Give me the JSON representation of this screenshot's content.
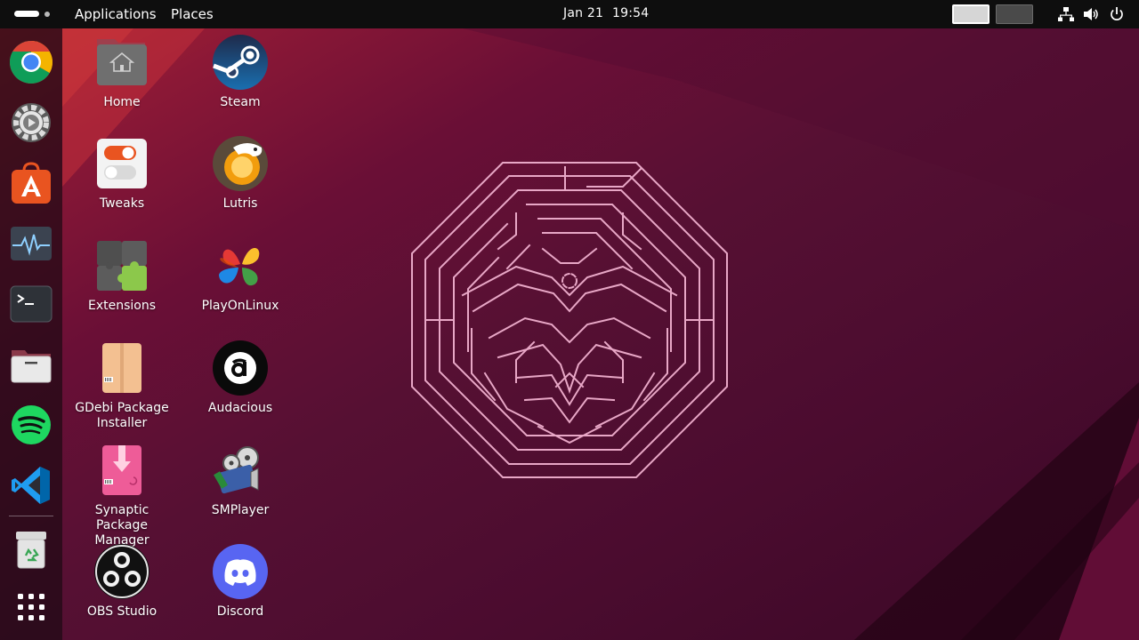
{
  "topbar": {
    "applications": "Applications",
    "places": "Places",
    "date": "Jan 21",
    "time": "19:54",
    "icons": [
      "network-icon",
      "volume-icon",
      "power-icon"
    ]
  },
  "dock": {
    "items": [
      {
        "name": "Google Chrome",
        "icon": "chrome-icon"
      },
      {
        "name": "Settings",
        "icon": "settings-icon"
      },
      {
        "name": "App Center",
        "icon": "app-center-icon"
      },
      {
        "name": "System Monitor",
        "icon": "system-monitor-icon"
      },
      {
        "name": "Terminal",
        "icon": "terminal-icon"
      },
      {
        "name": "Files",
        "icon": "files-icon"
      },
      {
        "name": "Spotify",
        "icon": "spotify-icon"
      },
      {
        "name": "Visual Studio Code",
        "icon": "vscode-icon"
      },
      {
        "name": "Trash",
        "icon": "trash-icon"
      },
      {
        "name": "Show Apps",
        "icon": "app-grid-icon"
      }
    ]
  },
  "desktop": {
    "icons": [
      {
        "label": "Home"
      },
      {
        "label": "Steam"
      },
      {
        "label": "Tweaks"
      },
      {
        "label": "Lutris"
      },
      {
        "label": "Extensions"
      },
      {
        "label": "PlayOnLinux"
      },
      {
        "label": "GDebi Package Installer"
      },
      {
        "label": "Audacious"
      },
      {
        "label": "Synaptic Package Manager"
      },
      {
        "label": "SMPlayer"
      },
      {
        "label": "OBS Studio"
      },
      {
        "label": "Discord"
      }
    ]
  },
  "colors": {
    "topbar": "#0e0e0e",
    "wallpaper_accent": "#b3262f",
    "ubuntu_orange": "#e95420"
  }
}
